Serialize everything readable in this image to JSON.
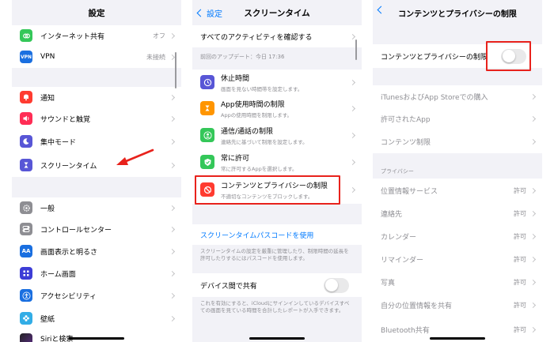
{
  "colors": {
    "accent": "#007aff",
    "highlight": "#e8221c",
    "separator": "#d9d9dd",
    "background": "#f2f2f7"
  },
  "p1": {
    "title": "設定",
    "items": [
      {
        "label": "インターネット共有",
        "value": "オフ",
        "icon": "link-icon",
        "color": "#34c759"
      },
      {
        "label": "VPN",
        "value": "未接続",
        "icon": "vpn-icon",
        "color": "#1a6fe0"
      },
      {
        "label": "通知",
        "value": "",
        "icon": "bell-icon",
        "color": "#ff3b30"
      },
      {
        "label": "サウンドと触覚",
        "value": "",
        "icon": "speaker-icon",
        "color": "#ff2d55"
      },
      {
        "label": "集中モード",
        "value": "",
        "icon": "moon-icon",
        "color": "#5856d6"
      },
      {
        "label": "スクリーンタイム",
        "value": "",
        "icon": "hourglass-icon",
        "color": "#5856d6"
      },
      {
        "label": "一般",
        "value": "",
        "icon": "gear-icon",
        "color": "#8e8e93"
      },
      {
        "label": "コントロールセンター",
        "value": "",
        "icon": "toggles-icon",
        "color": "#8e8e93"
      },
      {
        "label": "画面表示と明るさ",
        "value": "",
        "icon": "text-size-icon",
        "color": "#1a6fe0"
      },
      {
        "label": "ホーム画面",
        "value": "",
        "icon": "home-grid-icon",
        "color": "#3d3dd6"
      },
      {
        "label": "アクセシビリティ",
        "value": "",
        "icon": "accessibility-icon",
        "color": "#1a6fe0"
      },
      {
        "label": "壁紙",
        "value": "",
        "icon": "flower-icon",
        "color": "#32ade6"
      },
      {
        "label": "Siriと検索",
        "value": "",
        "icon": "siri-icon",
        "color": "#333333"
      }
    ]
  },
  "p2": {
    "back": "設定",
    "title": "スクリーンタイム",
    "all_activity": "すべてのアクティビティを確認する",
    "last_update": "前回のアップデート：今日 17:36",
    "items": [
      {
        "label": "休止時間",
        "sub": "画面を見ない時間帯を設定します。",
        "icon": "downtime-icon",
        "color": "#5856d6"
      },
      {
        "label": "App使用時間の制限",
        "sub": "Appの使用時間を制限します。",
        "icon": "hourglass-icon",
        "color": "#ff9500"
      },
      {
        "label": "通信/通話の制限",
        "sub": "連絡先に基づいて制限を設定します。",
        "icon": "person-icon",
        "color": "#34c759"
      },
      {
        "label": "常に許可",
        "sub": "常に許可するAppを選択します。",
        "icon": "checkmark-icon",
        "color": "#34c759"
      },
      {
        "label": "コンテンツとプライバシーの制限",
        "sub": "不適切なコンテンツをブロックします。",
        "icon": "restrict-icon",
        "color": "#ff3b30"
      }
    ],
    "passcode_link": "スクリーンタイムパスコードを使用",
    "passcode_desc": "スクリーンタイムの設定を厳重に管理したり、制限時間の延長を許可したりするにはパスコードを使用します。",
    "share_label": "デバイス間で共有",
    "share_desc": "これを有効にすると、iCloudにサインインしているデバイスすべての画面を見ている時間を合計したレポートが入手できます。"
  },
  "p3": {
    "title": "コンテンツとプライバシーの制限",
    "toggle_label": "コンテンツとプライバシーの制限",
    "group1": [
      {
        "label": "iTunesおよびApp Storeでの購入",
        "value": ""
      },
      {
        "label": "許可されたApp",
        "value": ""
      },
      {
        "label": "コンテンツ制限",
        "value": ""
      }
    ],
    "privacy_header": "プライバシー",
    "group2": [
      {
        "label": "位置情報サービス",
        "value": "許可"
      },
      {
        "label": "連絡先",
        "value": "許可"
      },
      {
        "label": "カレンダー",
        "value": "許可"
      },
      {
        "label": "リマインダー",
        "value": "許可"
      },
      {
        "label": "写真",
        "value": "許可"
      },
      {
        "label": "自分の位置情報を共有",
        "value": "許可"
      },
      {
        "label": "Bluetooth共有",
        "value": "許可"
      }
    ]
  }
}
